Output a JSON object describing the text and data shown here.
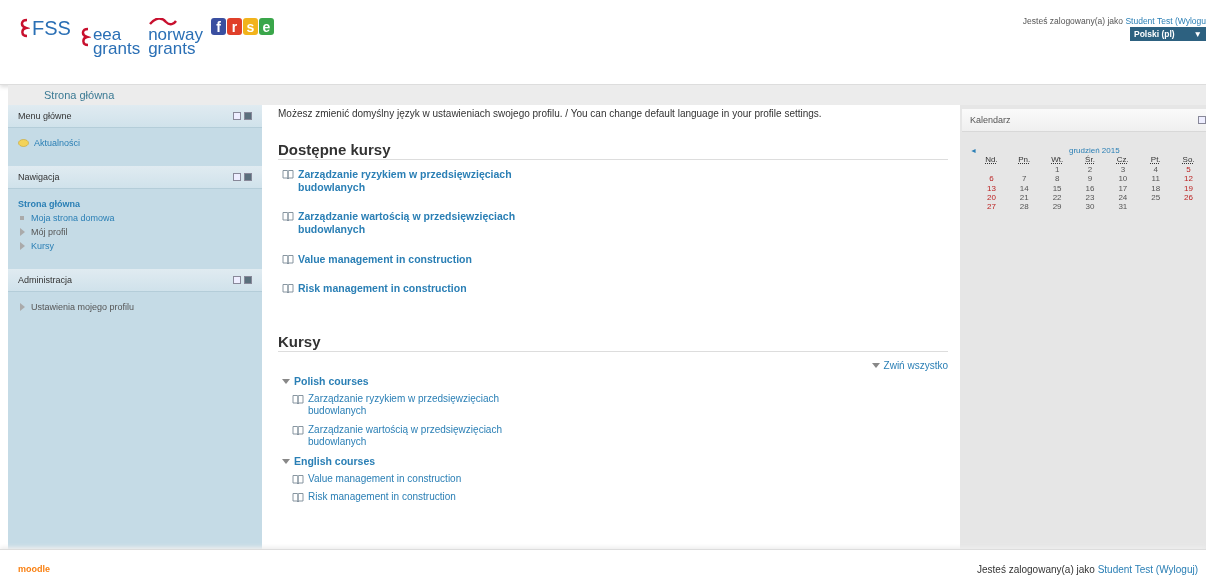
{
  "header": {
    "logos": [
      {
        "kind": "fss",
        "text": "FSS"
      },
      {
        "kind": "eea",
        "lines": [
          "eea",
          "grants"
        ]
      },
      {
        "kind": "norway",
        "lines": [
          "norway",
          "grants"
        ]
      },
      {
        "kind": "frse",
        "letters": [
          "f",
          "r",
          "s",
          "e"
        ]
      }
    ],
    "login": {
      "prefix": "Jesteś zalogowany(a) jako",
      "user": "Student Test",
      "logout": "(Wylogu"
    },
    "language": {
      "value": "Polski (pl)",
      "caret": "▼"
    }
  },
  "breadcrumb": [
    {
      "label": "Strona główna"
    }
  ],
  "left_blocks": [
    {
      "title": "Menu główne",
      "items": [
        {
          "label": "Aktualności",
          "kind": "forum",
          "link": true
        }
      ]
    },
    {
      "title": "Nawigacja",
      "tree": {
        "label": "Strona główna",
        "children": [
          {
            "label": "Moja strona domowa",
            "kind": "bullet",
            "link": true
          },
          {
            "label": "Mój profil",
            "kind": "arrow",
            "link": false
          },
          {
            "label": "Kursy",
            "kind": "arrow",
            "link": true
          }
        ]
      }
    },
    {
      "title": "Administracja",
      "items": [
        {
          "label": "Ustawienia mojego profilu",
          "kind": "arrow",
          "link": false
        }
      ]
    }
  ],
  "notice": "Możesz zmienić domyślny język w ustawieniach swojego profilu. / You can change default language in your profile settings.",
  "available_courses": {
    "title": "Dostępne kursy",
    "courses": [
      {
        "lines": [
          "Zarządzanie ryzykiem w przedsięwzięciach",
          "budowlanych"
        ]
      },
      {
        "lines": [
          "Zarządzanie wartością w przedsięwzięciach",
          "budowlanych"
        ]
      },
      {
        "lines": [
          "Value management in construction"
        ]
      },
      {
        "lines": [
          "Risk management in construction"
        ]
      }
    ]
  },
  "courses": {
    "title": "Kursy",
    "collapse_all": "Zwiń wszystko",
    "categories": [
      {
        "name": "Polish courses",
        "expanded": true,
        "courses": [
          {
            "lines": [
              "Zarządzanie ryzykiem w przedsięwzięciach",
              "budowlanych"
            ]
          },
          {
            "lines": [
              "Zarządzanie wartością w przedsięwzięciach",
              "budowlanych"
            ]
          }
        ]
      },
      {
        "name": "English courses",
        "expanded": true,
        "courses": [
          {
            "lines": [
              "Value management in construction"
            ]
          },
          {
            "lines": [
              "Risk management in construction"
            ]
          }
        ]
      }
    ]
  },
  "calendar": {
    "title": "Kalendarz",
    "prev": "◄",
    "month": "grudzień 2015",
    "weekdays": [
      "Nd.",
      "Pn.",
      "Wt.",
      "Śr.",
      "Cz.",
      "Pt.",
      "So."
    ],
    "weeks": [
      [
        {
          "day": "1",
          "weekend": false
        },
        {
          "day": "2",
          "weekend": false
        },
        {
          "day": "3",
          "weekend": false
        },
        {
          "day": "4",
          "weekend": false
        },
        {
          "day": "5",
          "weekend": true
        }
      ],
      [
        {
          "day": "6",
          "weekend": true
        },
        {
          "day": "7",
          "weekend": false
        },
        {
          "day": "8",
          "weekend": false
        },
        {
          "day": "9",
          "weekend": false
        },
        {
          "day": "10",
          "weekend": false
        },
        {
          "day": "11",
          "weekend": false
        },
        {
          "day": "12",
          "weekend": true
        }
      ],
      [
        {
          "day": "13",
          "weekend": true
        },
        {
          "day": "14",
          "weekend": false
        },
        {
          "day": "15",
          "weekend": false
        },
        {
          "day": "16",
          "weekend": false
        },
        {
          "day": "17",
          "weekend": false
        },
        {
          "day": "18",
          "weekend": false
        },
        {
          "day": "19",
          "weekend": true
        }
      ],
      [
        {
          "day": "20",
          "weekend": true
        },
        {
          "day": "21",
          "weekend": false
        },
        {
          "day": "22",
          "weekend": false
        },
        {
          "day": "23",
          "weekend": false
        },
        {
          "day": "24",
          "weekend": false
        },
        {
          "day": "25",
          "weekend": false
        },
        {
          "day": "26",
          "weekend": true
        }
      ],
      [
        {
          "day": "27",
          "weekend": true
        },
        {
          "day": "28",
          "weekend": false
        },
        {
          "day": "29",
          "weekend": false
        },
        {
          "day": "30",
          "weekend": false
        },
        {
          "day": "31",
          "weekend": false
        }
      ]
    ]
  },
  "footer": {
    "logo": "moodle",
    "login": {
      "prefix": "Jesteś zalogowany(a) jako",
      "user": "Student Test",
      "logout": "(Wyloguj)"
    }
  }
}
